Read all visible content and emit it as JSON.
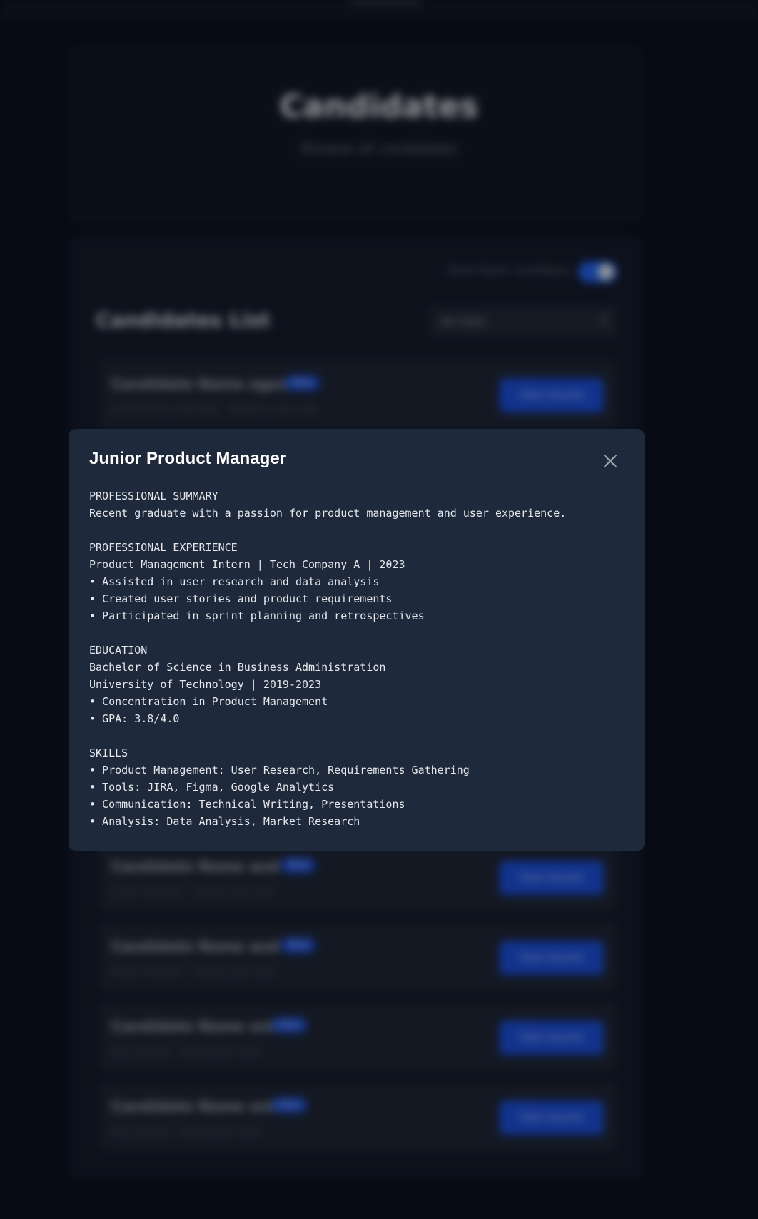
{
  "background": {
    "page_title": "Candidates",
    "page_subtitle": "Browse all candidates",
    "toggle_label": "Show fewer candidates",
    "list_title": "Candidates List",
    "filter_value": "All roles",
    "rows": [
      {
        "name": "Candidate Name aged 1",
        "badge": "New",
        "meta": "Junior Product Manager · Applied 2 days ago",
        "button": "View resume"
      },
      {
        "name": "Candidate Name and 2",
        "badge": "New",
        "meta": "Senior Designer · Applied last week",
        "button": "View resume"
      },
      {
        "name": "Candidate Name and 3",
        "badge": "New",
        "meta": "Senior Designer · Applied last week",
        "button": "View resume"
      },
      {
        "name": "Candidate Name ont 4",
        "badge": "New",
        "meta": "Data Analyst · Applied last week",
        "button": "View resume"
      },
      {
        "name": "Candidate Name ont 5",
        "badge": "New",
        "meta": "Data Analyst · Applied last week",
        "button": "View resume"
      }
    ]
  },
  "modal": {
    "title": "Junior Product Manager",
    "close_icon": "close-icon",
    "resume": "PROFESSIONAL SUMMARY\nRecent graduate with a passion for product management and user experience.\n\nPROFESSIONAL EXPERIENCE\nProduct Management Intern | Tech Company A | 2023\n• Assisted in user research and data analysis\n• Created user stories and product requirements\n• Participated in sprint planning and retrospectives\n\nEDUCATION\nBachelor of Science in Business Administration\nUniversity of Technology | 2019-2023\n• Concentration in Product Management\n• GPA: 3.8/4.0\n\nSKILLS\n• Product Management: User Research, Requirements Gathering\n• Tools: JIRA, Figma, Google Analytics\n• Communication: Technical Writing, Presentations\n• Analysis: Data Analysis, Market Research"
  },
  "colors": {
    "page_bg": "#0b1120",
    "modal_bg": "#1e293b",
    "accent": "#2563eb"
  }
}
